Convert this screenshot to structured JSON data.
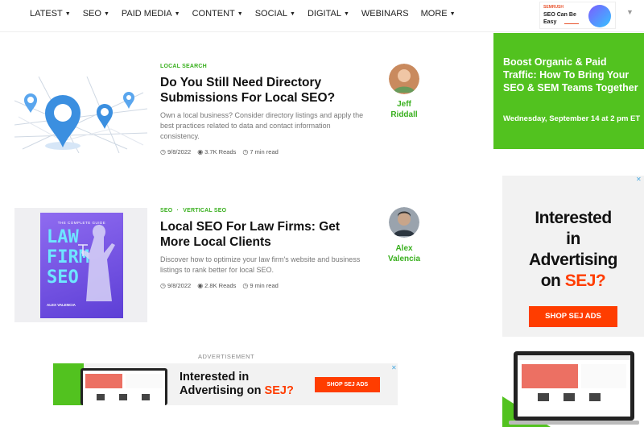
{
  "nav": {
    "items": [
      {
        "label": "LATEST",
        "caret": true
      },
      {
        "label": "SEO",
        "caret": true
      },
      {
        "label": "PAID MEDIA",
        "caret": true
      },
      {
        "label": "CONTENT",
        "caret": true
      },
      {
        "label": "SOCIAL",
        "caret": true
      },
      {
        "label": "DIGITAL",
        "caret": true
      },
      {
        "label": "WEBINARS",
        "caret": false
      },
      {
        "label": "MORE",
        "caret": true
      }
    ],
    "semrush": {
      "logo": "SEMRUSH",
      "tagline": "SEO Can Be Easy"
    }
  },
  "articles": [
    {
      "categories": [
        "LOCAL SEARCH"
      ],
      "title": "Do You Still Need Directory Submissions For Local SEO?",
      "excerpt": "Own a local business? Consider directory listings and apply the best practices related to data and contact information consistency.",
      "date": "9/8/2022",
      "reads": "3.7K Reads",
      "read_time": "7 min read",
      "author": "Jeff Riddall"
    },
    {
      "categories": [
        "SEO",
        "VERTICAL SEO"
      ],
      "title": "Local SEO For Law Firms: Get More Local Clients",
      "excerpt": "Discover how to optimize your law firm's website and business listings to rank better for local SEO.",
      "date": "9/8/2022",
      "reads": "2.8K Reads",
      "read_time": "9 min read",
      "author": "Alex Valencia",
      "cover": {
        "top": "THE COMPLETE GUIDE",
        "title": "LAW FIRM SEO",
        "author": "ALEX VALENCIA"
      }
    }
  ],
  "promo": {
    "title": "Boost Organic & Paid Traffic: How To Bring Your SEO & SEM Teams Together",
    "date": "Wednesday, September 14 at 2 pm ET"
  },
  "side_ad": {
    "line1": "Interested",
    "line2": "in",
    "line3": "Advertising",
    "line4a": "on ",
    "line4b": "SEJ?",
    "button": "SHOP SEJ ADS"
  },
  "bottom_ad": {
    "label": "ADVERTISEMENT",
    "line1": "Interested in",
    "line2a": "Advertising on ",
    "line2b": "SEJ?",
    "button": "SHOP SEJ ADS"
  },
  "colors": {
    "accent": "#3ab01f",
    "promo_green": "#52c21f",
    "ad_orange": "#ff3d00"
  }
}
